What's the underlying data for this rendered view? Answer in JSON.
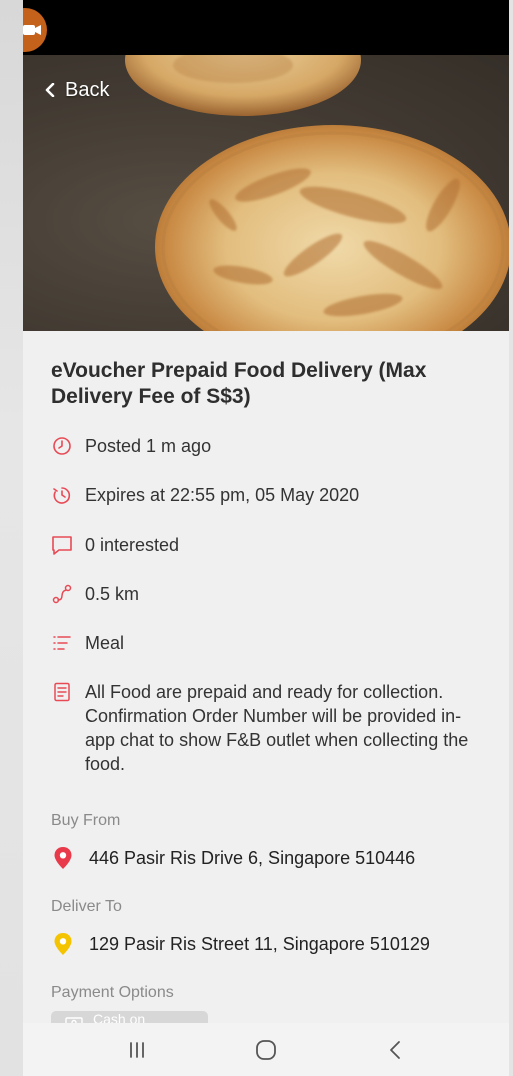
{
  "header": {
    "back_label": "Back"
  },
  "listing": {
    "title": "eVoucher Prepaid Food Delivery (Max Delivery Fee of S$3)",
    "posted": "Posted 1 m ago",
    "expires": "Expires at 22:55 pm, 05 May 2020",
    "interested": "0 interested",
    "distance": "0.5 km",
    "category": "Meal",
    "description": "All Food are prepaid and ready for collection. Confirmation Order Number will be provided in-app chat to show F&B outlet when collecting the food."
  },
  "buy_from": {
    "label": "Buy From",
    "address": "446 Pasir Ris Drive 6, Singapore 510446"
  },
  "deliver_to": {
    "label": "Deliver To",
    "address": "129 Pasir Ris Street 11, Singapore 510129"
  },
  "payment": {
    "label": "Payment Options",
    "option": "Cash on Delivery"
  },
  "colors": {
    "accent_red": "#e84a55",
    "pin_red": "#e83a4a",
    "pin_yellow": "#f5c400",
    "title_text": "#2e2e2e",
    "muted_label": "#8a8a8a",
    "chip_bg": "#d7d7d7"
  },
  "icons": {
    "back": "chevron-left-icon",
    "posted": "clock-icon",
    "expires": "timer-icon",
    "interested": "chat-bubble-icon",
    "distance": "route-icon",
    "category": "list-icon",
    "description": "document-icon",
    "buy_from": "location-pin-icon",
    "deliver_to": "location-pin-icon",
    "payment": "cash-icon",
    "nav_recent": "recent-apps-icon",
    "nav_home": "home-icon",
    "nav_back": "back-icon"
  }
}
